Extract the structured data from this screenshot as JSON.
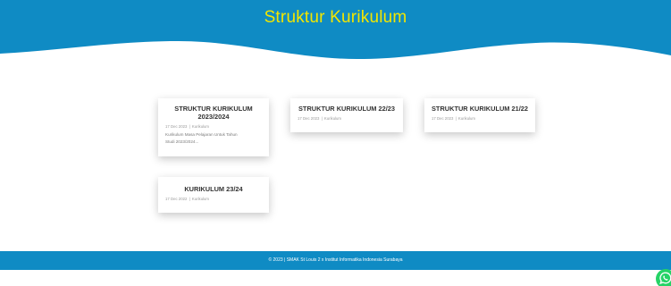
{
  "header": {
    "title": "Struktur Kurikulum"
  },
  "posts": [
    {
      "title": "STRUKTUR KURIKULUM 2023/2024",
      "date": "17 Dec 2023",
      "category": "Kurikulum",
      "excerpt": "Kurikulum Masa Pelajaran Untuk Tahun Studi 2023/2024..."
    },
    {
      "title": "STRUKTUR KURIKULUM 22/23",
      "date": "17 Dec 2023",
      "category": "Kurikulum"
    },
    {
      "title": "STRUKTUR KURIKULUM 21/22",
      "date": "17 Dec 2023",
      "category": "Kurikulum"
    },
    {
      "title": "KURIKULUM 23/24",
      "date": "17 Dec 2022",
      "category": "Kurikulum"
    }
  ],
  "meta_separator": "|",
  "footer": {
    "text": "© 2023 | SMAK St Louis 2 x Institut Informatika Indonesia Surabaya"
  },
  "floating": {
    "icon": "whatsapp-icon"
  },
  "colors": {
    "header_bg": "#0f8bc4",
    "title": "#f2e600",
    "footer_bg": "#0f8bc4",
    "whatsapp": "#25d366"
  }
}
